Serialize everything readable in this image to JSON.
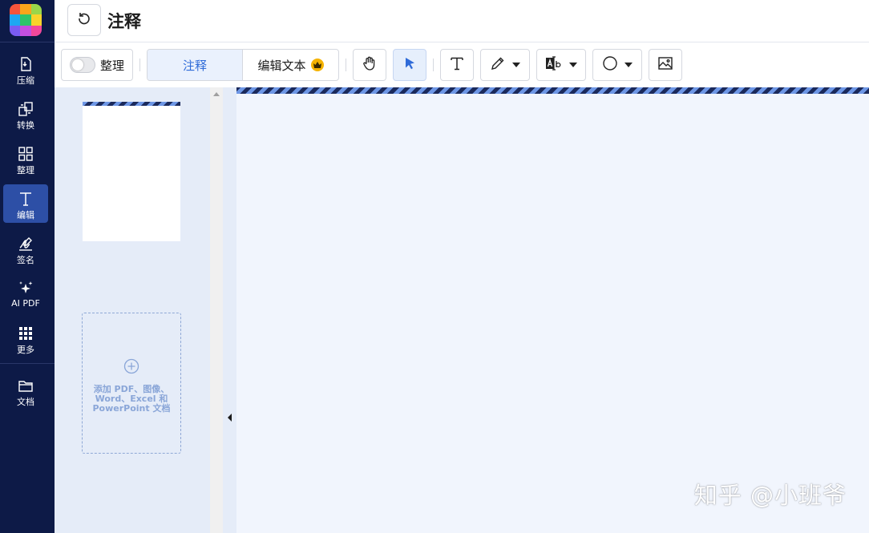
{
  "header": {
    "title": "注释"
  },
  "sidebar": {
    "items": [
      {
        "label": "压缩",
        "icon": "compress-icon"
      },
      {
        "label": "转换",
        "icon": "convert-icon"
      },
      {
        "label": "整理",
        "icon": "organize-grid-icon"
      },
      {
        "label": "编辑",
        "icon": "edit-text-icon",
        "active": true
      },
      {
        "label": "签名",
        "icon": "signature-icon"
      },
      {
        "label": "AI PDF",
        "icon": "ai-sparkle-icon"
      },
      {
        "label": "更多",
        "icon": "more-grid-icon"
      },
      {
        "label": "文档",
        "icon": "folder-icon"
      }
    ]
  },
  "toolbar": {
    "organize_toggle_label": "整理",
    "organize_toggle_on": false,
    "tabs": [
      {
        "label": "注释",
        "active": true
      },
      {
        "label": "编辑文本",
        "premium": true
      }
    ],
    "tools": [
      "hand-icon",
      "select-cursor-icon",
      "text-tool-icon",
      "pen-icon",
      "ocr-icon",
      "shape-circle-icon",
      "image-icon"
    ]
  },
  "thumbnails": {
    "add_files_text": "添加 PDF、图像、Word、Excel 和 PowerPoint 文档"
  },
  "watermark": "知乎 @小班爷",
  "colors": {
    "rail_bg": "#0d1a47",
    "rail_active": "#2d4fa6",
    "accent": "#2f6bd8",
    "panel_bg": "#e5ecf8",
    "canvas_bg": "#f1f5fd",
    "premium_crown": "#f5b301"
  }
}
